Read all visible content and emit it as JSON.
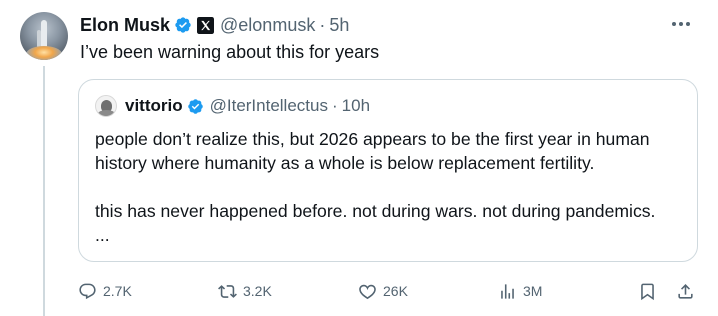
{
  "tweet": {
    "author_name": "Elon Musk",
    "handle": "@elonmusk",
    "separator": "·",
    "time": "5h",
    "text": "I’ve been warning about this for years",
    "more_label": "···"
  },
  "quote": {
    "author_name": "vittorio",
    "handle": "@IterIntellectus",
    "separator": "·",
    "time": "10h",
    "lines": [
      "people don’t realize this, but 2026 appears to be the first year in human",
      "history where humanity as a whole is below replacement fertility.",
      "this has never happened before. not during wars. not during pandemics.",
      "..."
    ]
  },
  "actions": {
    "replies": "2.7K",
    "reposts": "3.2K",
    "likes": "26K",
    "views": "3M"
  },
  "colors": {
    "verified": "#1d9bf0",
    "muted": "#536471",
    "text": "#0f1419",
    "border": "#cfd9de"
  },
  "icons": [
    "verified-badge-icon",
    "x-logo-icon",
    "more-icon",
    "reply-icon",
    "repost-icon",
    "like-icon",
    "views-icon",
    "bookmark-icon",
    "share-icon"
  ]
}
